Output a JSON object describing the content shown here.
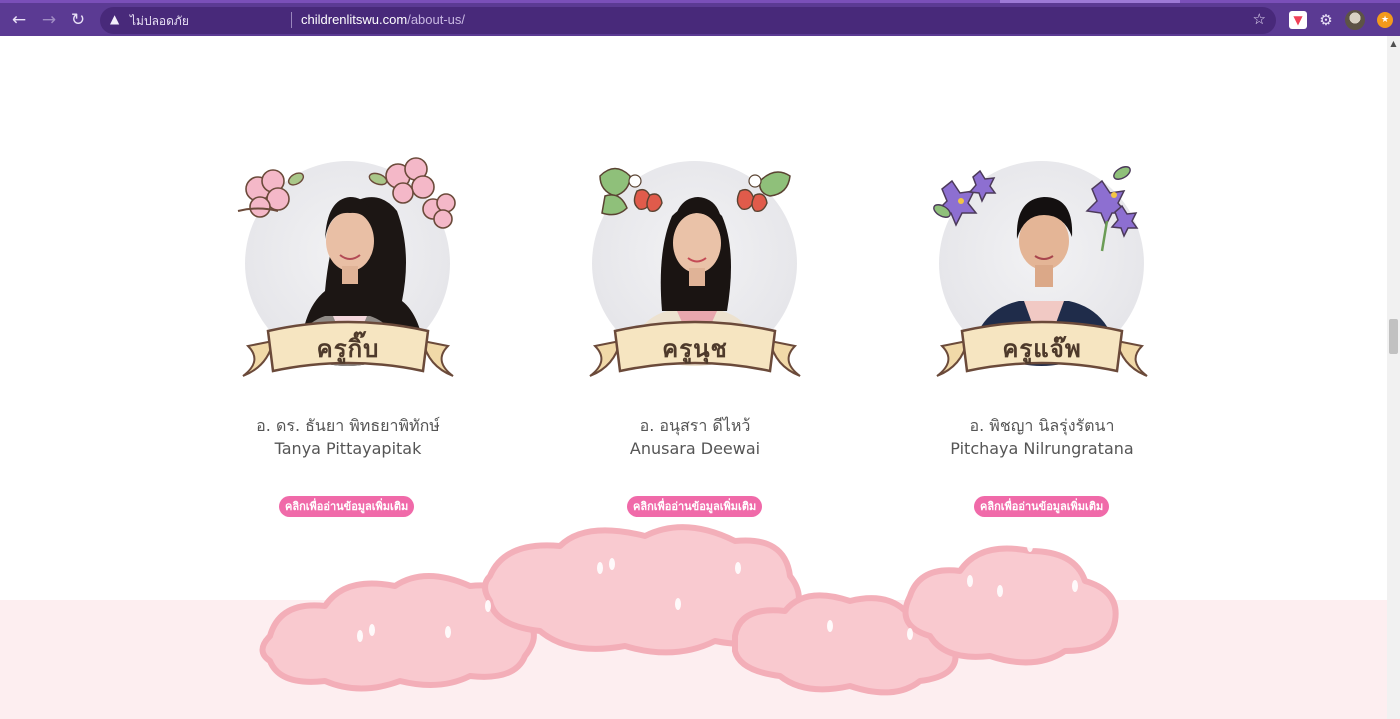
{
  "browser": {
    "security_label": "ไม่ปลอดภัย",
    "url_host": "childrenlitswu.com",
    "url_path": "/about-us/",
    "back_icon": "arrow-left-icon",
    "forward_icon": "arrow-right-icon",
    "reload_icon": "reload-icon",
    "warning_icon": "warning-triangle-icon",
    "bookmark_icon": "star-icon",
    "extensions": [
      "pocket-icon",
      "puzzle-icon",
      "profile-avatar-icon",
      "orange-extension-icon"
    ]
  },
  "teachers": [
    {
      "nickname": "ครูกิ๊บ",
      "name_th": "อ. ดร. ธันยา พิทธยาพิทักษ์",
      "name_en": "Tanya Pittayapitak",
      "more_label": "คลิกเพื่ออ่านข้อมูลเพิ่มเติม",
      "flower_color": "#f4b8c8",
      "jacket_color": "#8f8a86",
      "shirt_color": "#f3d7dc",
      "hair_color": "#1c1614"
    },
    {
      "nickname": "ครูนุช",
      "name_th": "อ. อนุสรา ดีไหว้",
      "name_en": "Anusara Deewai",
      "more_label": "คลิกเพื่ออ่านข้อมูลเพิ่มเติม",
      "flower_color": "#e05b4b",
      "jacket_color": "#ede2cf",
      "shirt_color": "#e8a7ae",
      "hair_color": "#1a1412"
    },
    {
      "nickname": "ครูแจ๊พ",
      "name_th": "อ. พิชญา นิลรุ่งรัตนา",
      "name_en": "Pitchaya Nilrungratana",
      "more_label": "คลิกเพื่ออ่านข้อมูลเพิ่มเติม",
      "flower_color": "#8d6fd1",
      "jacket_color": "#1f2c4a",
      "shirt_color": "#f1c9c4",
      "hair_color": "#141010"
    }
  ],
  "colors": {
    "chrome": "#5b3a93",
    "button_pink": "#f06aa9",
    "band_pink": "#fdeef0",
    "cloud_pink": "#f7b9c2"
  }
}
